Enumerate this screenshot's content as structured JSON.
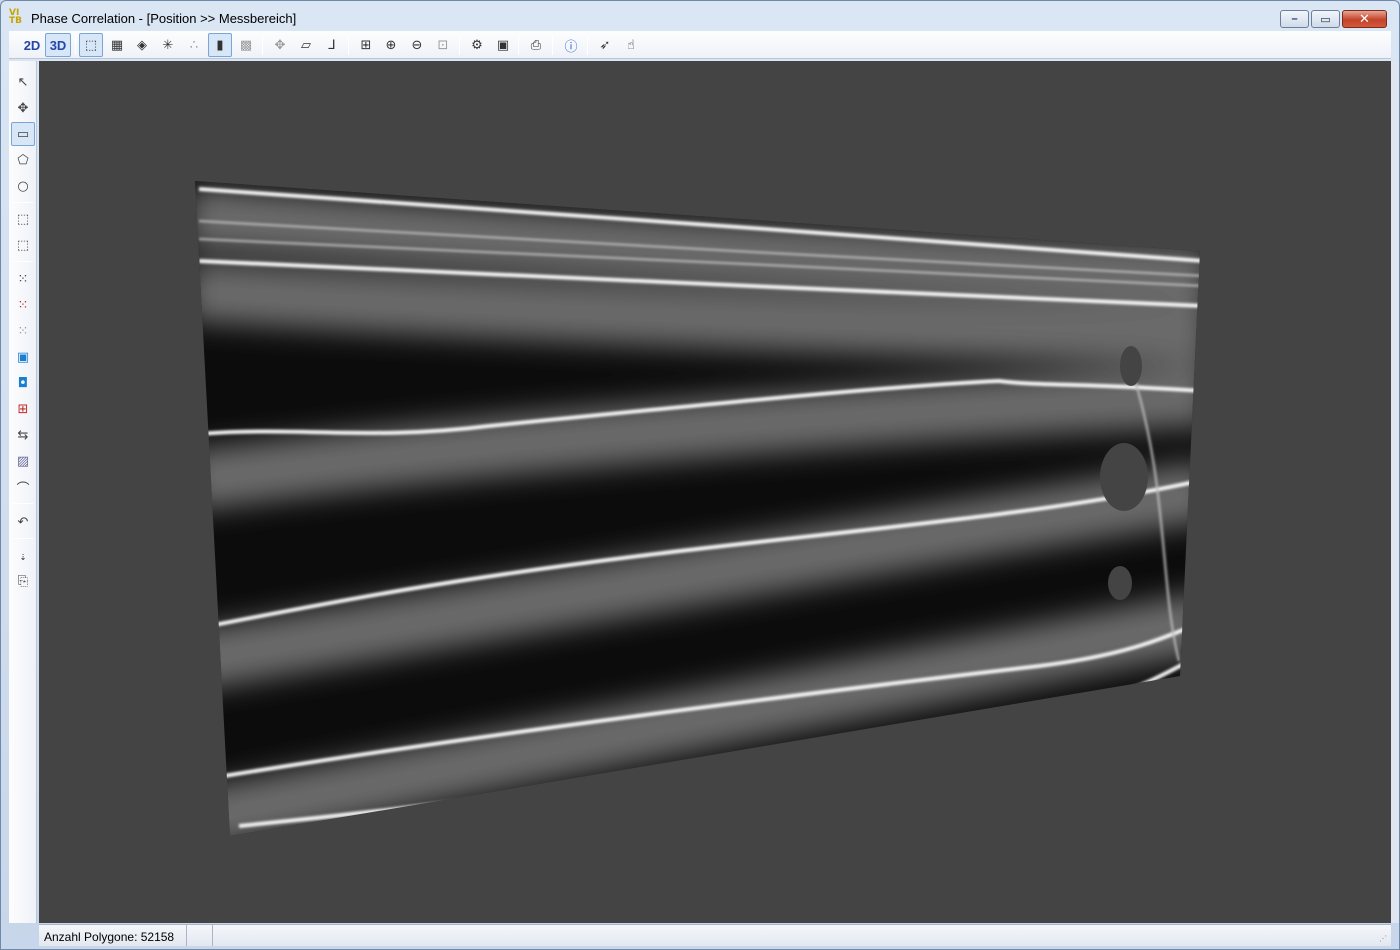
{
  "window": {
    "title": "Phase Correlation - [Position >> Messbereich]",
    "app_icon_text": "VI\nTB"
  },
  "caption": {
    "minimize": "–",
    "maximize": "▭",
    "close": "✕"
  },
  "toolbar": {
    "view_2d_label": "2D",
    "view_3d_label": "3D"
  },
  "statusbar": {
    "polygon_count": "Anzahl Polygone: 52158"
  },
  "colors": {
    "viewport_bg": "#444444",
    "toolbar_active_border": "#7aa6d6"
  }
}
